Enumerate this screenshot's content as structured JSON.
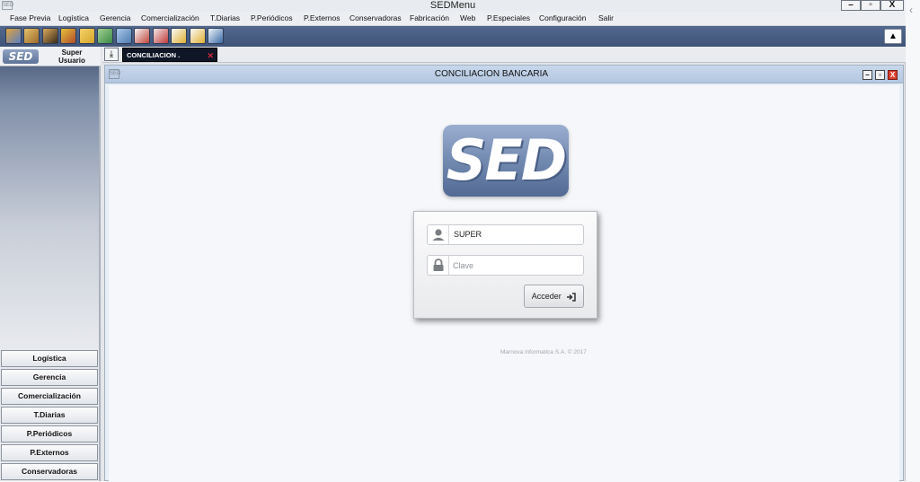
{
  "window": {
    "title": "SEDMenu",
    "controls": [
      "–",
      "▫",
      "X"
    ]
  },
  "menu": [
    "Fase Previa",
    "Logística",
    "Gerencia",
    "Comercialización",
    "T.Diarias",
    "P.Periódicos",
    "P.Externos",
    "Conservadoras",
    "Fabricación",
    "Web",
    "P.Especiales",
    "Configuración",
    "Salir"
  ],
  "toolbar": {
    "icons": [
      "book-icon",
      "box-icon",
      "person-icon",
      "puzzle-icon",
      "folder-icon",
      "money-icon",
      "map-icon",
      "open-book-icon",
      "calculator-icon",
      "pencil-icon",
      "pencil-check-icon",
      "chart-icon"
    ],
    "eject_icon": "▲"
  },
  "user": {
    "logo": "SED",
    "name_line1": "Super",
    "name_line2": "Usuario"
  },
  "modules": [
    "Logística",
    "Gerencia",
    "Comercialización",
    "T.Diarias",
    "P.Periódicos",
    "P.Externos",
    "Conservadoras"
  ],
  "tab": {
    "label": "CONCILIACION .",
    "close": "✕",
    "download_icon": "⤓"
  },
  "inner": {
    "title": "CONCILIACION BANCARIA",
    "controls": [
      "–",
      "▫",
      "X"
    ],
    "logo": "SED",
    "login": {
      "user_value": "SUPER",
      "password_placeholder": "Clave",
      "submit_label": "Acceder"
    },
    "copyright": "Marnova informatica S.A. © 2017"
  },
  "colors": {
    "toolbar": "#4a5f85",
    "tab_bg": "#0f1727",
    "close_red": "#d5253a"
  }
}
